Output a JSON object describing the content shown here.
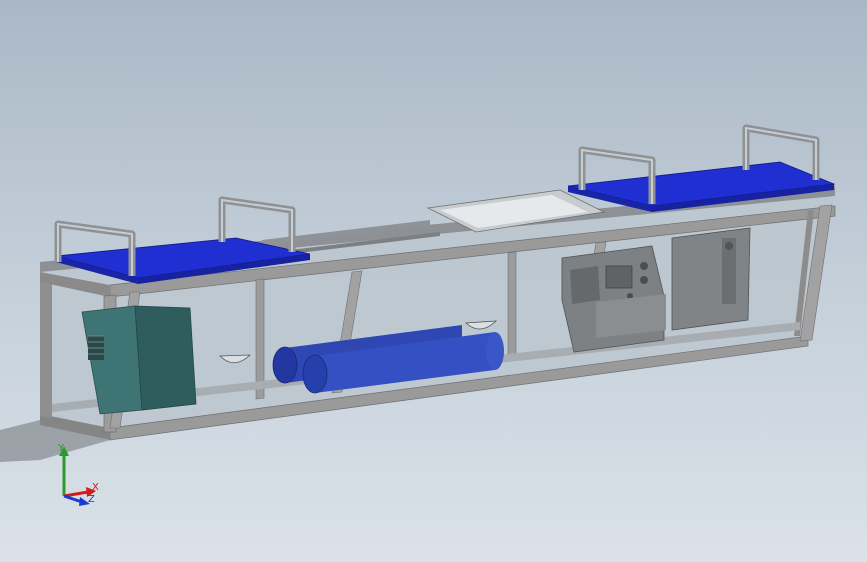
{
  "viewport": {
    "background_top": "#aab8c6",
    "background_bottom": "#dbe2e8"
  },
  "model": {
    "frame_color": "#9a9a9a",
    "frame_dark": "#6f6f6f",
    "glass_color": "#bcc6cf",
    "seat_color": "#1f2fd1",
    "tank_color": "#3a6a6a",
    "pipe_color": "#2e47b3",
    "device_color": "#7b7f82"
  },
  "triad": {
    "x_label": "X",
    "y_label": "Y",
    "z_label": "Z",
    "x_color": "#d11a1a",
    "y_color": "#2a9a2a",
    "z_color": "#1a3ad1"
  }
}
